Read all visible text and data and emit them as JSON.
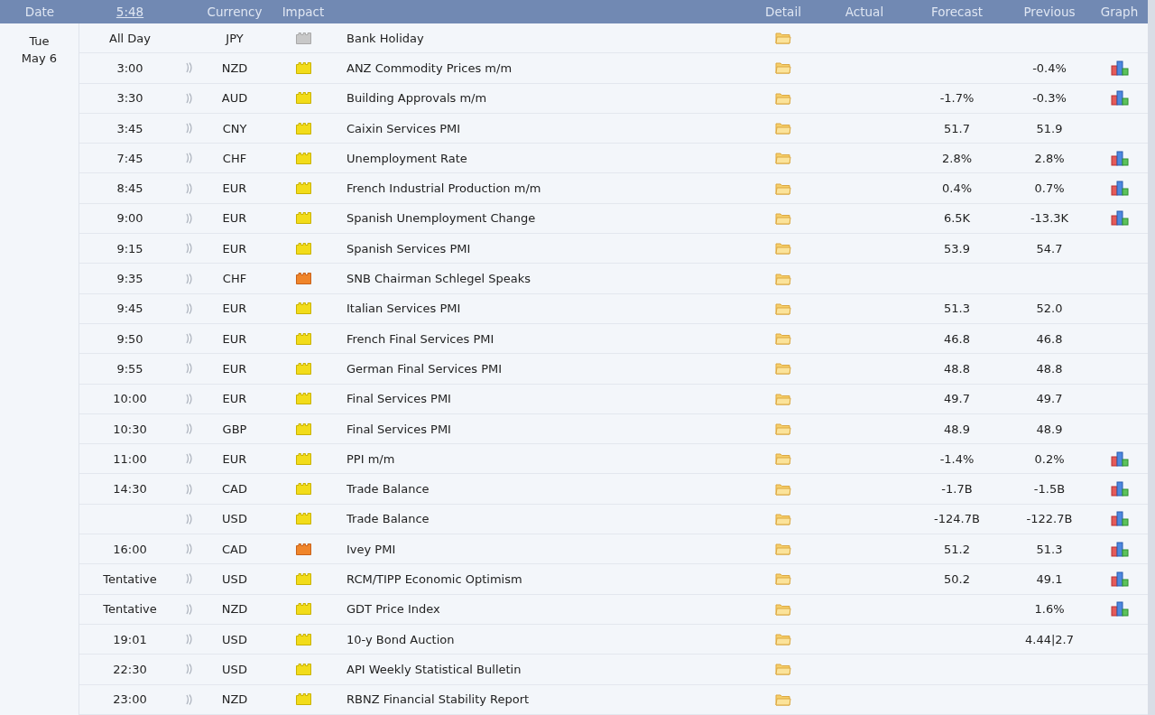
{
  "header": {
    "date": "Date",
    "time": "5:48",
    "currency": "Currency",
    "impact": "Impact",
    "detail": "Detail",
    "actual": "Actual",
    "forecast": "Forecast",
    "previous": "Previous",
    "graph": "Graph"
  },
  "day": {
    "weekday": "Tue",
    "date": "May 6"
  },
  "rows": [
    {
      "time": "All Day",
      "alert": false,
      "currency": "JPY",
      "kind": "holiday",
      "event": "Bank Holiday",
      "forecast": "",
      "previous": "",
      "graph": false
    },
    {
      "time": "3:00",
      "alert": true,
      "currency": "NZD",
      "kind": "low",
      "event": "ANZ Commodity Prices m/m",
      "forecast": "",
      "previous": "-0.4%",
      "graph": true
    },
    {
      "time": "3:30",
      "alert": true,
      "currency": "AUD",
      "kind": "low",
      "event": "Building Approvals m/m",
      "forecast": "-1.7%",
      "previous": "-0.3%",
      "graph": true
    },
    {
      "time": "3:45",
      "alert": true,
      "currency": "CNY",
      "kind": "low",
      "event": "Caixin Services PMI",
      "forecast": "51.7",
      "previous": "51.9",
      "graph": false
    },
    {
      "time": "7:45",
      "alert": true,
      "currency": "CHF",
      "kind": "low",
      "event": "Unemployment Rate",
      "forecast": "2.8%",
      "previous": "2.8%",
      "graph": true
    },
    {
      "time": "8:45",
      "alert": true,
      "currency": "EUR",
      "kind": "low",
      "event": "French Industrial Production m/m",
      "forecast": "0.4%",
      "previous": "0.7%",
      "graph": true
    },
    {
      "time": "9:00",
      "alert": true,
      "currency": "EUR",
      "kind": "low",
      "event": "Spanish Unemployment Change",
      "forecast": "6.5K",
      "previous": "-13.3K",
      "graph": true
    },
    {
      "time": "9:15",
      "alert": true,
      "currency": "EUR",
      "kind": "low",
      "event": "Spanish Services PMI",
      "forecast": "53.9",
      "previous": "54.7",
      "graph": false
    },
    {
      "time": "9:35",
      "alert": true,
      "currency": "CHF",
      "kind": "medium",
      "event": "SNB Chairman Schlegel Speaks",
      "forecast": "",
      "previous": "",
      "graph": false
    },
    {
      "time": "9:45",
      "alert": true,
      "currency": "EUR",
      "kind": "low",
      "event": "Italian Services PMI",
      "forecast": "51.3",
      "previous": "52.0",
      "graph": false
    },
    {
      "time": "9:50",
      "alert": true,
      "currency": "EUR",
      "kind": "low",
      "event": "French Final Services PMI",
      "forecast": "46.8",
      "previous": "46.8",
      "graph": false
    },
    {
      "time": "9:55",
      "alert": true,
      "currency": "EUR",
      "kind": "low",
      "event": "German Final Services PMI",
      "forecast": "48.8",
      "previous": "48.8",
      "graph": false
    },
    {
      "time": "10:00",
      "alert": true,
      "currency": "EUR",
      "kind": "low",
      "event": "Final Services PMI",
      "forecast": "49.7",
      "previous": "49.7",
      "graph": false
    },
    {
      "time": "10:30",
      "alert": true,
      "currency": "GBP",
      "kind": "low",
      "event": "Final Services PMI",
      "forecast": "48.9",
      "previous": "48.9",
      "graph": false
    },
    {
      "time": "11:00",
      "alert": true,
      "currency": "EUR",
      "kind": "low",
      "event": "PPI m/m",
      "forecast": "-1.4%",
      "previous": "0.2%",
      "graph": true
    },
    {
      "time": "14:30",
      "alert": true,
      "currency": "CAD",
      "kind": "low",
      "event": "Trade Balance",
      "forecast": "-1.7B",
      "previous": "-1.5B",
      "graph": true
    },
    {
      "time": "",
      "alert": true,
      "currency": "USD",
      "kind": "low",
      "event": "Trade Balance",
      "forecast": "-124.7B",
      "previous": "-122.7B",
      "graph": true
    },
    {
      "time": "16:00",
      "alert": true,
      "currency": "CAD",
      "kind": "medium",
      "event": "Ivey PMI",
      "forecast": "51.2",
      "previous": "51.3",
      "graph": true
    },
    {
      "time": "Tentative",
      "alert": true,
      "currency": "USD",
      "kind": "low",
      "event": "RCM/TIPP Economic Optimism",
      "forecast": "50.2",
      "previous": "49.1",
      "graph": true
    },
    {
      "time": "Tentative",
      "alert": true,
      "currency": "NZD",
      "kind": "low",
      "event": "GDT Price Index",
      "forecast": "",
      "previous": "1.6%",
      "graph": true
    },
    {
      "time": "19:01",
      "alert": true,
      "currency": "USD",
      "kind": "low",
      "event": "10-y Bond Auction",
      "forecast": "",
      "previous": "4.44|2.7",
      "graph": false
    },
    {
      "time": "22:30",
      "alert": true,
      "currency": "USD",
      "kind": "low",
      "event": "API Weekly Statistical Bulletin",
      "forecast": "",
      "previous": "",
      "graph": false
    },
    {
      "time": "23:00",
      "alert": true,
      "currency": "NZD",
      "kind": "low",
      "event": "RBNZ Financial Stability Report",
      "forecast": "",
      "previous": "",
      "graph": false
    }
  ]
}
